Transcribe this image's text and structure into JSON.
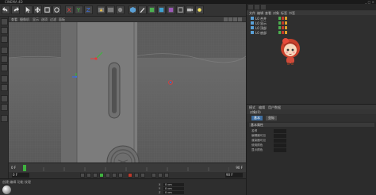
{
  "window": {
    "title": "CINEMA 4D",
    "controls": "_ □ ×"
  },
  "viewport": {
    "menu": [
      "查看",
      "摄像机",
      "显示",
      "选项",
      "过滤",
      "面板"
    ],
    "label": "透视视图"
  },
  "object_manager": {
    "menu": [
      "文件",
      "编辑",
      "查看",
      "对象",
      "标签",
      "书签"
    ],
    "rows": [
      {
        "label": "L0 合并"
      },
      {
        "label": "L0 显示"
      },
      {
        "label": "L0 顶部"
      },
      {
        "label": "L0 底部"
      }
    ]
  },
  "attributes": {
    "tabs": [
      "模式",
      "编辑",
      "用户数据"
    ],
    "header": "对象(0)",
    "sub_tabs": [
      "基本",
      "坐标"
    ],
    "section": "基本属性",
    "rows": [
      {
        "label": "名称"
      },
      {
        "label": "编辑器可见"
      },
      {
        "label": "渲染器可见"
      },
      {
        "label": "使用颜色"
      },
      {
        "label": "显示颜色"
      }
    ]
  },
  "timeline": {
    "frame_start": "0 F",
    "frame_end": "90 F",
    "current_frame": "0 F",
    "max_frame": "90 F"
  },
  "materials": {
    "menu": "创建 编辑 功能 纹理"
  },
  "coordinates": {
    "rows": [
      {
        "label": "X",
        "value": "0 cm"
      },
      {
        "label": "Y",
        "value": "0 cm"
      },
      {
        "label": "Z",
        "value": "0 cm"
      }
    ]
  },
  "colors": {
    "axis_x": "#e23b3b",
    "axis_y": "#3fb23f",
    "axis_z": "#3a6ee0",
    "accent": "#3f6ea0"
  },
  "icons": [
    "undo-icon",
    "redo-icon",
    "select-icon",
    "move-icon",
    "scale-icon",
    "rotate-icon",
    "render-icon",
    "cube-icon",
    "pen-icon",
    "light-icon",
    "camera-icon"
  ]
}
